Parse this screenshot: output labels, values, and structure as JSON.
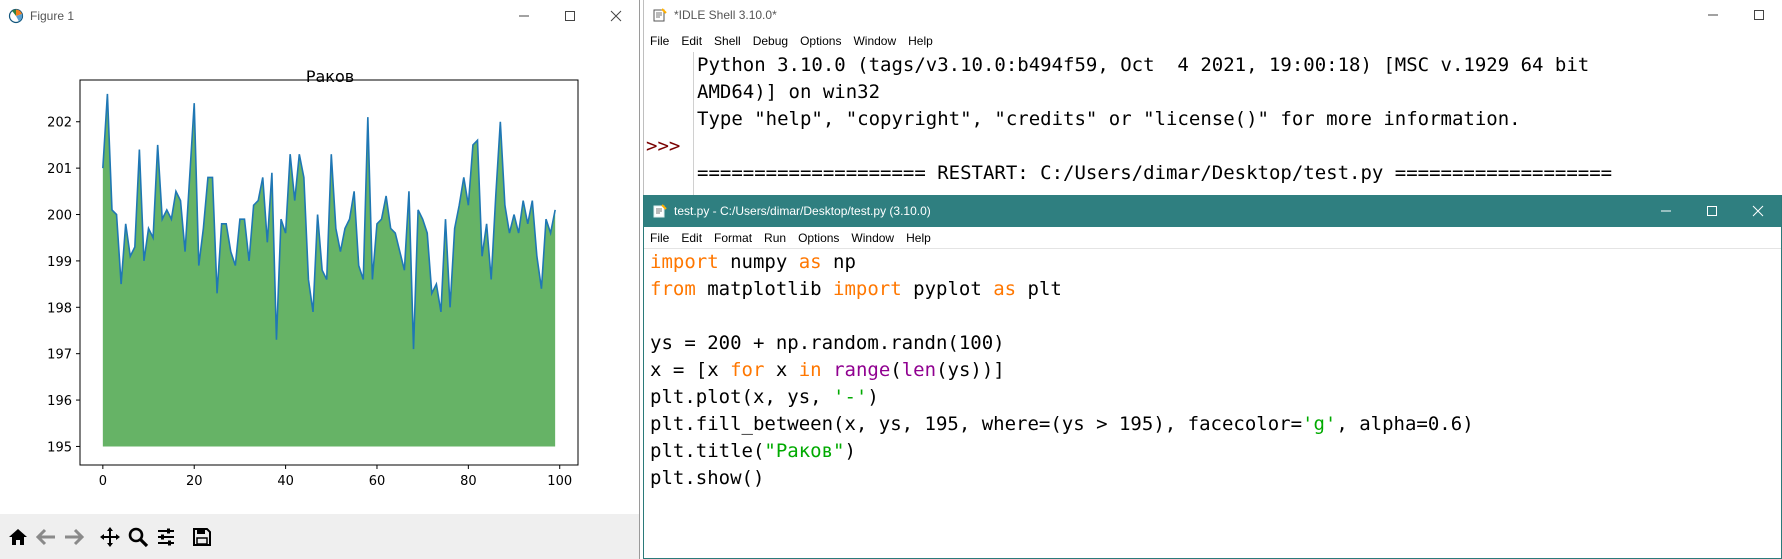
{
  "figure_window": {
    "title": "Figure 1",
    "toolbar": [
      "home-icon",
      "back-arrow-icon",
      "forward-arrow-icon",
      "pan-icon",
      "zoom-icon",
      "configure-icon",
      "save-icon"
    ]
  },
  "chart_data": {
    "type": "area",
    "title": "Раков",
    "xlabel": "",
    "ylabel": "",
    "xlim": [
      -5,
      104
    ],
    "ylim": [
      194.6,
      202.9
    ],
    "xticks": [
      "0",
      "20",
      "40",
      "60",
      "80",
      "100"
    ],
    "xtick_values": [
      0,
      20,
      40,
      60,
      80,
      100
    ],
    "yticks": [
      "195",
      "196",
      "197",
      "198",
      "199",
      "200",
      "201",
      "202"
    ],
    "ytick_values": [
      195,
      196,
      197,
      198,
      199,
      200,
      201,
      202
    ],
    "fill_baseline": 195,
    "line_color": "#1f77b4",
    "fill_color": "#008000",
    "fill_alpha": 0.6,
    "grid": false,
    "x": [
      0,
      1,
      2,
      3,
      4,
      5,
      6,
      7,
      8,
      9,
      10,
      11,
      12,
      13,
      14,
      15,
      16,
      17,
      18,
      19,
      20,
      21,
      22,
      23,
      24,
      25,
      26,
      27,
      28,
      29,
      30,
      31,
      32,
      33,
      34,
      35,
      36,
      37,
      38,
      39,
      40,
      41,
      42,
      43,
      44,
      45,
      46,
      47,
      48,
      49,
      50,
      51,
      52,
      53,
      54,
      55,
      56,
      57,
      58,
      59,
      60,
      61,
      62,
      63,
      64,
      65,
      66,
      67,
      68,
      69,
      70,
      71,
      72,
      73,
      74,
      75,
      76,
      77,
      78,
      79,
      80,
      81,
      82,
      83,
      84,
      85,
      86,
      87,
      88,
      89,
      90,
      91,
      92,
      93,
      94,
      95,
      96,
      97,
      98,
      99
    ],
    "y": [
      201.0,
      202.6,
      200.1,
      200.0,
      198.5,
      199.8,
      199.1,
      199.3,
      201.4,
      199.0,
      199.7,
      199.5,
      201.5,
      199.9,
      200.1,
      199.9,
      200.5,
      200.3,
      199.2,
      200.8,
      202.4,
      198.9,
      199.7,
      200.8,
      200.8,
      198.3,
      199.8,
      199.8,
      199.2,
      198.9,
      199.9,
      199.9,
      199.0,
      200.2,
      200.3,
      200.8,
      199.4,
      200.9,
      197.3,
      199.9,
      199.6,
      201.3,
      200.3,
      201.3,
      200.8,
      198.6,
      197.9,
      200.0,
      198.8,
      198.6,
      201.3,
      199.7,
      199.2,
      199.7,
      199.9,
      200.5,
      198.9,
      198.6,
      202.1,
      198.6,
      199.8,
      199.9,
      200.4,
      199.7,
      199.6,
      199.2,
      198.8,
      200.5,
      197.1,
      200.1,
      199.9,
      199.6,
      198.3,
      198.5,
      197.9,
      199.9,
      198.0,
      199.7,
      200.2,
      200.8,
      200.2,
      201.5,
      201.6,
      199.1,
      199.8,
      198.6,
      200.4,
      202.0,
      200.2,
      199.6,
      200.0,
      199.6,
      200.3,
      199.8,
      200.3,
      199.1,
      198.4,
      199.9,
      199.6,
      200.1
    ]
  },
  "shell_window": {
    "title": "*IDLE Shell 3.10.0*",
    "menu": [
      "File",
      "Edit",
      "Shell",
      "Debug",
      "Options",
      "Window",
      "Help"
    ],
    "lines": [
      "Python 3.10.0 (tags/v3.10.0:b494f59, Oct  4 2021, 19:00:18) [MSC v.1929 64 bit",
      "AMD64)] on win32",
      "Type \"help\", \"copyright\", \"credits\" or \"license()\" for more information.",
      "",
      "==================== RESTART: C:/Users/dimar/Desktop/test.py ==================="
    ],
    "prompt": ">>>"
  },
  "editor_window": {
    "title": "test.py - C:/Users/dimar/Desktop/test.py (3.10.0)",
    "menu": [
      "File",
      "Edit",
      "Format",
      "Run",
      "Options",
      "Window",
      "Help"
    ],
    "code_lines": [
      [
        {
          "t": "import",
          "c": "kw"
        },
        {
          "t": " numpy "
        },
        {
          "t": "as",
          "c": "kw"
        },
        {
          "t": " np"
        }
      ],
      [
        {
          "t": "from",
          "c": "kw"
        },
        {
          "t": " matplotlib "
        },
        {
          "t": "import",
          "c": "kw"
        },
        {
          "t": " pyplot "
        },
        {
          "t": "as",
          "c": "kw"
        },
        {
          "t": " plt"
        }
      ],
      [],
      [
        {
          "t": "ys = 200 + np.random.randn(100)"
        }
      ],
      [
        {
          "t": "x = [x "
        },
        {
          "t": "for",
          "c": "kw"
        },
        {
          "t": " x "
        },
        {
          "t": "in",
          "c": "kw"
        },
        {
          "t": " "
        },
        {
          "t": "range",
          "c": "bi"
        },
        {
          "t": "("
        },
        {
          "t": "len",
          "c": "bi"
        },
        {
          "t": "(ys))]"
        }
      ],
      [
        {
          "t": "plt.plot(x, ys, "
        },
        {
          "t": "'-'",
          "c": "st"
        },
        {
          "t": ")"
        }
      ],
      [
        {
          "t": "plt.fill_between(x, ys, 195, where=(ys > 195), facecolor="
        },
        {
          "t": "'g'",
          "c": "st"
        },
        {
          "t": ", alpha=0.6)"
        }
      ],
      [
        {
          "t": "plt.title("
        },
        {
          "t": "\"Раков\"",
          "c": "st"
        },
        {
          "t": ")"
        }
      ],
      [
        {
          "t": "plt.show()"
        }
      ]
    ]
  }
}
